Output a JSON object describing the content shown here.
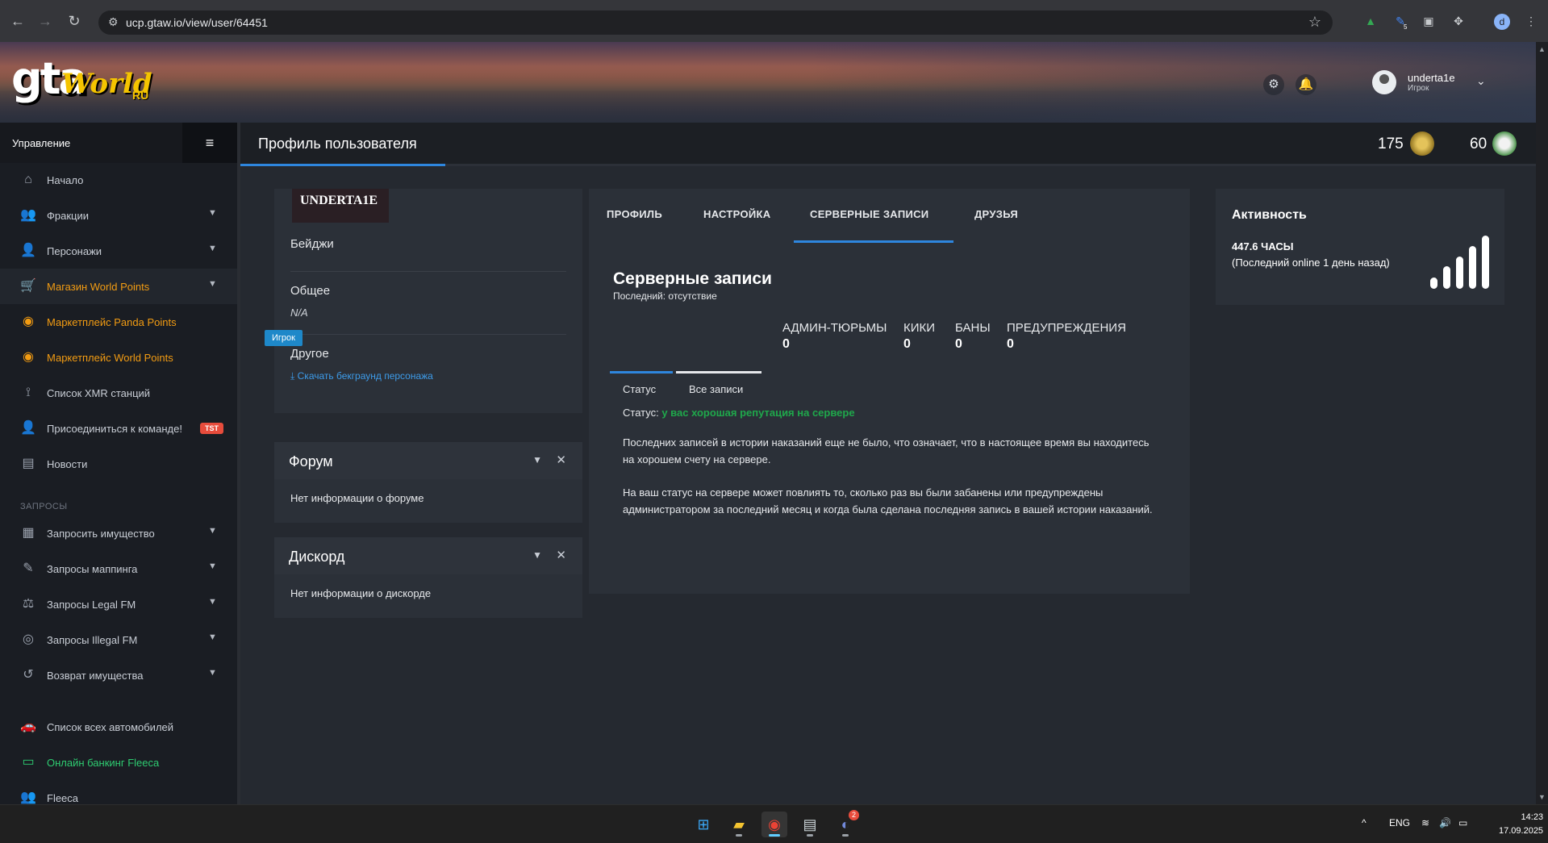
{
  "browser": {
    "url": "ucp.gtaw.io/view/user/64451",
    "profile_initial": "d",
    "extension_badge": "5"
  },
  "header": {
    "logo": {
      "gta": "gta",
      "world": "World",
      "ru": "RU"
    },
    "user": {
      "name": "underta1e",
      "role": "Игрок"
    }
  },
  "sidebar": {
    "title": "Управление",
    "items": [
      {
        "label": "Начало",
        "icon": "home-icon"
      },
      {
        "label": "Фракции",
        "icon": "users-icon"
      },
      {
        "label": "Персонажи",
        "icon": "user-icon"
      },
      {
        "label": "Магазин World Points",
        "icon": "cart-icon"
      },
      {
        "label": "Маркетплейс Panda Points",
        "icon": "coins-icon"
      },
      {
        "label": "Маркетплейс World Points",
        "icon": "coins-icon"
      },
      {
        "label": "Список XMR станций",
        "icon": "antenna-icon"
      },
      {
        "label": "Присоединиться к команде!",
        "icon": "user-tie-icon",
        "badge": "TST"
      },
      {
        "label": "Новости",
        "icon": "newspaper-icon"
      }
    ],
    "section_requests": "ЗАПРОСЫ",
    "requests": [
      {
        "label": "Запросить имущество",
        "icon": "building-icon"
      },
      {
        "label": "Запросы маппинга",
        "icon": "brush-icon"
      },
      {
        "label": "Запросы Legal FM",
        "icon": "scale-icon"
      },
      {
        "label": "Запросы Illegal FM",
        "icon": "mask-icon"
      },
      {
        "label": "Возврат имущества",
        "icon": "undo-icon"
      }
    ],
    "bottom": [
      {
        "label": "Список всех автомобилей",
        "icon": "car-icon"
      },
      {
        "label": "Онлайн банкинг Fleeca",
        "icon": "bank-card-icon"
      },
      {
        "label": "Fleeca",
        "icon": "users-icon"
      }
    ]
  },
  "page": {
    "title": "Профиль пользователя",
    "stats": [
      {
        "value": "175",
        "icon": "rank-badge-icon"
      },
      {
        "value": "60",
        "icon": "panda-badge-icon"
      }
    ]
  },
  "profile_card": {
    "username": "UNDERTA1E",
    "role": "Игрок",
    "badges_label": "Бейджи",
    "general_label": "Общее",
    "general_value": "N/A",
    "other_label": "Другое",
    "download_link": "Скачать бекграунд персонажа"
  },
  "forum_widget": {
    "title": "Форум",
    "body": "Нет информации о форуме"
  },
  "discord_widget": {
    "title": "Дискорд",
    "body": "Нет информации о дискорде"
  },
  "records_card": {
    "tabs": [
      "ПРОФИЛЬ",
      "НАСТРОЙКА",
      "СЕРВЕРНЫЕ ЗАПИСИ",
      "ДРУЗЬЯ"
    ],
    "active_tab": "СЕРВЕРНЫЕ ЗАПИСИ",
    "title": "Серверные записи",
    "subtitle": "Последний: отсутствие",
    "counters": [
      {
        "label": "АДМИН-ТЮРЬМЫ",
        "value": "0"
      },
      {
        "label": "КИКИ",
        "value": "0"
      },
      {
        "label": "БАНЫ",
        "value": "0"
      },
      {
        "label": "ПРЕДУПРЕЖДЕНИЯ",
        "value": "0"
      }
    ],
    "subtabs": [
      "Статус",
      "Все записи"
    ],
    "status_label": "Статус:",
    "status_value": "у вас хорошая репутация на сервере",
    "status_color": "#1fa84b",
    "paragraph1": "Последних записей в истории наказаний еще не было, что означает, что в настоящее время вы находитесь на хорошем счету на сервере.",
    "paragraph2": "На ваш статус на сервере может повлиять то, сколько раз вы были забанены или предупреждены администратором за последний месяц и когда была сделана последняя запись в вашей истории наказаний."
  },
  "activity_card": {
    "title": "Активность",
    "hours": "447.6 ЧАСЫ",
    "last_online": "(Последний online 1 день назад)",
    "signal_level": 1.0
  },
  "taskbar": {
    "lang": "ENG",
    "time": "14:23",
    "date": "17.09.2025",
    "discord_badge": "2"
  },
  "colors": {
    "accent": "#2e86de",
    "orange": "#f39c12",
    "green": "#2ecc71",
    "danger": "#e74c3c"
  }
}
